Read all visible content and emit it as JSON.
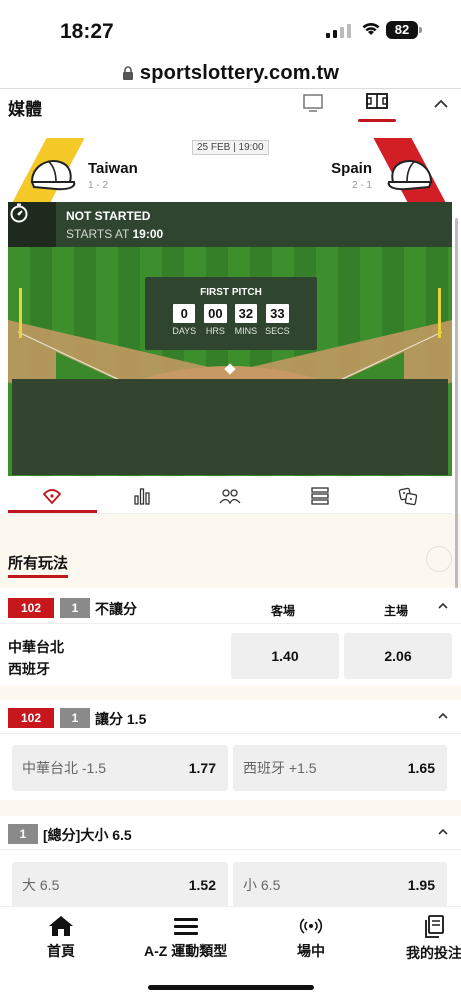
{
  "status_bar": {
    "time": "18:27",
    "battery": "82"
  },
  "browser": {
    "url": "sportslottery.com.tw"
  },
  "media_section": {
    "title": "媒體"
  },
  "match": {
    "date": "25 FEB | 19:00",
    "home_team": {
      "name": "Taiwan",
      "record": "1 - 2"
    },
    "away_team": {
      "name": "Spain",
      "record": "2 - 1"
    }
  },
  "field": {
    "status": "NOT STARTED",
    "starts_label": "STARTS AT",
    "starts_time": "19:00",
    "countdown_title": "FIRST PITCH",
    "countdown": [
      {
        "value": "0",
        "unit": "DAYS"
      },
      {
        "value": "00",
        "unit": "HRS"
      },
      {
        "value": "32",
        "unit": "MINS"
      },
      {
        "value": "33",
        "unit": "SECS"
      }
    ]
  },
  "all_bets": {
    "title": "所有玩法"
  },
  "markets": [
    {
      "code": "102",
      "num": "1",
      "title": "不讓分",
      "col_away": "客場",
      "col_home": "主場",
      "teams": [
        "中華台北",
        "西班牙"
      ],
      "odds": [
        "1.40",
        "2.06"
      ]
    },
    {
      "code": "102",
      "num": "1",
      "title": "讓分 1.5",
      "options": [
        {
          "label": "中華台北 -1.5",
          "odd": "1.77"
        },
        {
          "label": "西班牙 +1.5",
          "odd": "1.65"
        }
      ]
    },
    {
      "num": "1",
      "title": "[總分]大小 6.5",
      "options": [
        {
          "label": "大 6.5",
          "odd": "1.52"
        },
        {
          "label": "小 6.5",
          "odd": "1.95"
        }
      ]
    }
  ],
  "tab_bar": [
    {
      "label": "首頁",
      "icon": "home-icon"
    },
    {
      "label": "A-Z 運動類型",
      "icon": "menu-icon"
    },
    {
      "label": "場中",
      "icon": "live-broadcast-icon"
    },
    {
      "label": "我的投注",
      "icon": "my-bets-icon"
    }
  ],
  "colors": {
    "accent": "#c0161d",
    "field_green": "#3a8a2c",
    "home_stripe": "#f5c928",
    "away_stripe": "#d21f26"
  }
}
